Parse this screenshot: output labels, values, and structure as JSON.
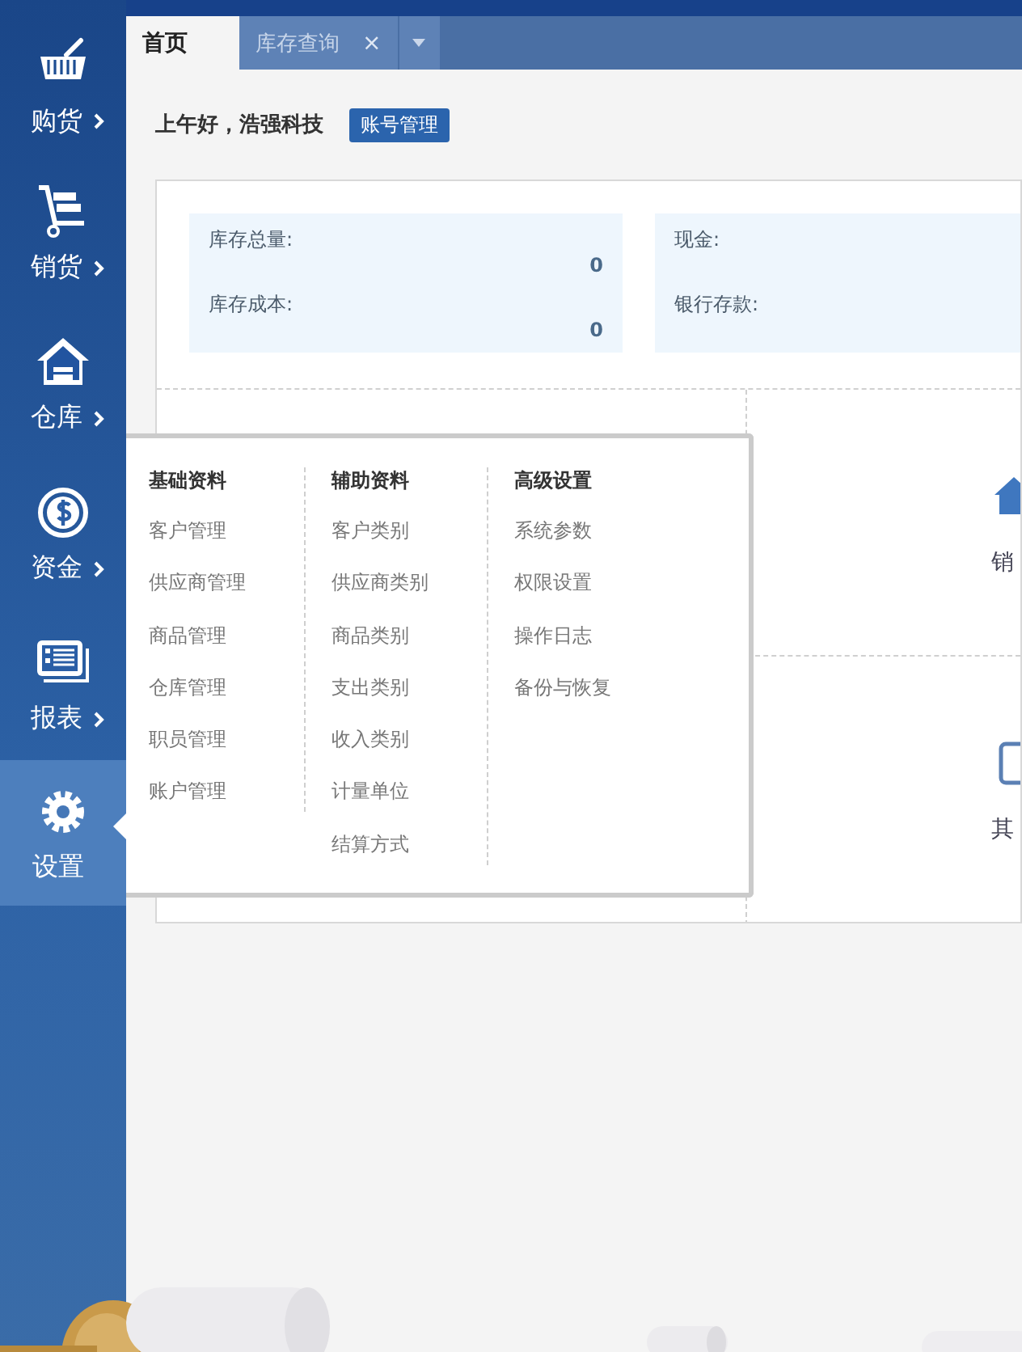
{
  "sidebar": {
    "items": [
      {
        "label": "购货",
        "submenu": true,
        "selected": false
      },
      {
        "label": "销货",
        "submenu": true,
        "selected": false
      },
      {
        "label": "仓库",
        "submenu": true,
        "selected": false
      },
      {
        "label": "资金",
        "submenu": true,
        "selected": false
      },
      {
        "label": "报表",
        "submenu": true,
        "selected": false
      },
      {
        "label": "设置",
        "submenu": false,
        "selected": true
      }
    ]
  },
  "tabs": [
    {
      "label": "首页",
      "selected": true
    },
    {
      "label": "库存查询",
      "selected": false,
      "close": "×"
    }
  ],
  "greeting": "上午好，浩强科技",
  "account_button": "账号管理",
  "stats": [
    {
      "rows": [
        {
          "label": "库存总量:",
          "value": "0"
        },
        {
          "label": "库存成本:",
          "value": "0"
        }
      ]
    },
    {
      "rows": [
        {
          "label": "现金:"
        },
        {
          "label": "银行存款:"
        }
      ]
    }
  ],
  "shortcuts": [
    {
      "label": "销"
    },
    {
      "label": "其"
    }
  ],
  "menu": {
    "columns": [
      {
        "title": "基础资料",
        "items": [
          "客户管理",
          "供应商管理",
          "商品管理",
          "仓库管理",
          "职员管理",
          "账户管理"
        ]
      },
      {
        "title": "辅助资料",
        "items": [
          "客户类别",
          "供应商类别",
          "商品类别",
          "支出类别",
          "收入类别",
          "计量单位",
          "结算方式"
        ]
      },
      {
        "title": "高级设置",
        "items": [
          "系统参数",
          "权限设置",
          "操作日志",
          "备份与恢复"
        ]
      }
    ]
  }
}
